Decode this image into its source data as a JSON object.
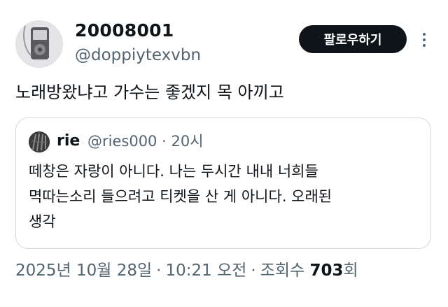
{
  "author": {
    "display_name": "20008001",
    "handle": "@doppiytexvbn",
    "avatar_icon": "ipod-avatar-icon"
  },
  "actions": {
    "follow_label": "팔로우하기",
    "more_icon": "more-options-icon"
  },
  "tweet": {
    "text": "노래방왔냐고 가수는 좋겠지 목 아끼고"
  },
  "quoted_tweet": {
    "display_name": "rie",
    "handle": "@ries000",
    "separator": "·",
    "time_ago": "20시",
    "body_lines": [
      "떼창은 자랑이 아니다. 나는 두시간 내내 너희들",
      "멱따는소리 들으려고 티켓을 산 게 아니다. 오래된",
      "생각"
    ]
  },
  "meta": {
    "date": "2025년 10월 28일",
    "time": "10:21 오전",
    "separator": "·",
    "views_label": "조회수",
    "views_count": "703",
    "views_suffix": "회"
  },
  "colors": {
    "text_primary": "#0f1419",
    "text_secondary": "#536471",
    "border": "#cfd9de",
    "follow_bg": "#0f1419"
  }
}
